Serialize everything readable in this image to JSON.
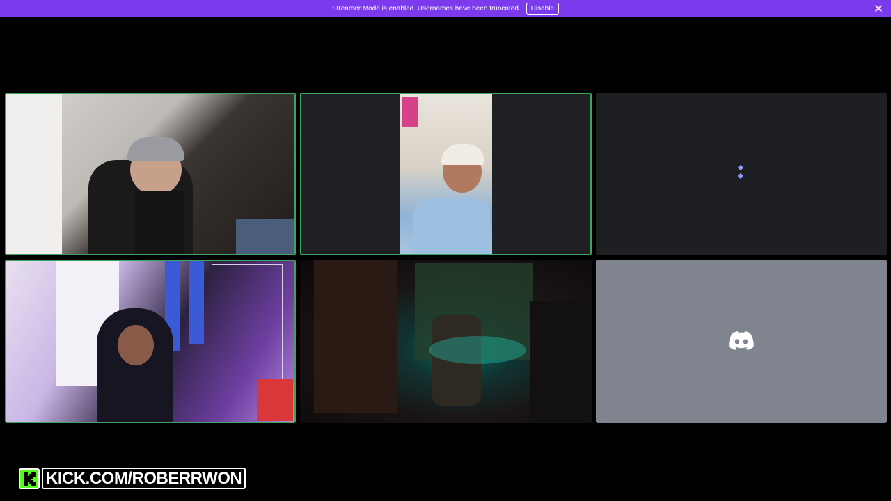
{
  "banner": {
    "text": "Streamer Mode is enabled. Usernames have been truncated.",
    "button_label": "Disable",
    "color": "#7c3aed"
  },
  "grid": {
    "tiles": [
      {
        "id": "participant-1",
        "kind": "video",
        "speaking": true
      },
      {
        "id": "participant-2",
        "kind": "video",
        "speaking": true
      },
      {
        "id": "participant-3",
        "kind": "loading",
        "speaking": false
      },
      {
        "id": "participant-4",
        "kind": "video",
        "speaking": true
      },
      {
        "id": "participant-5",
        "kind": "video",
        "speaking": false
      },
      {
        "id": "participant-6",
        "kind": "avatar",
        "icon": "discord-logo-icon",
        "speaking": false
      }
    ],
    "speaking_color": "#3ba55d"
  },
  "overlay": {
    "brand_icon": "kick-logo-icon",
    "url": "KICK.COM/ROBERRWON",
    "accent": "#53fc18"
  }
}
